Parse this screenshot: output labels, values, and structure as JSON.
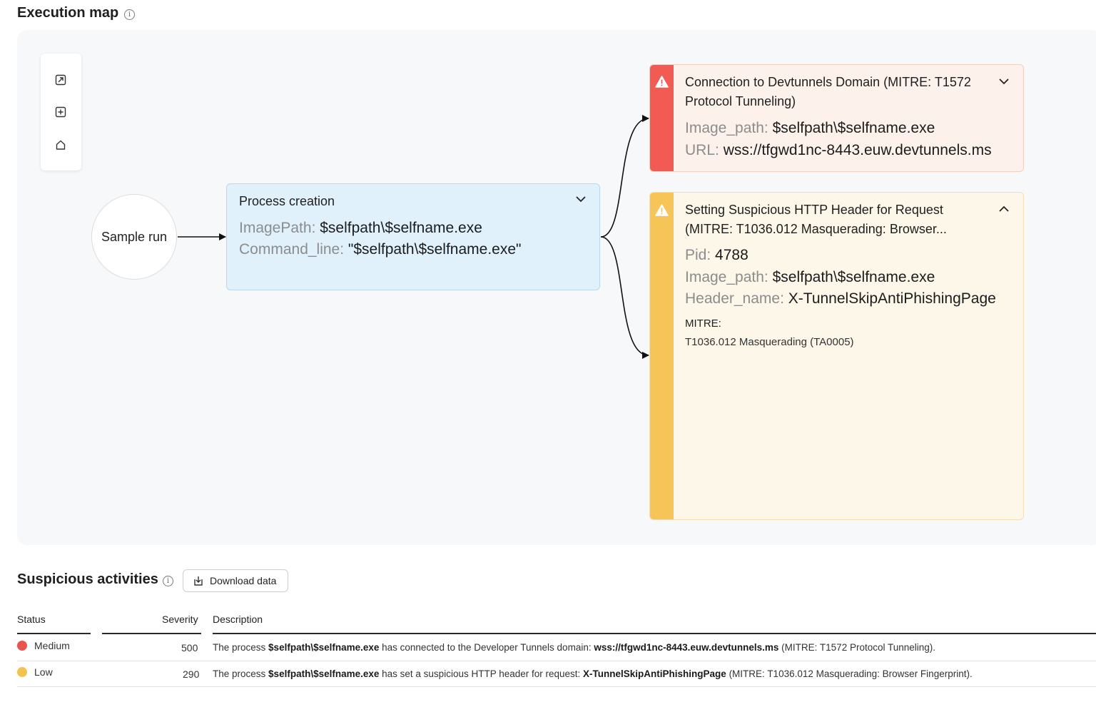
{
  "execution_map": {
    "title": "Execution map",
    "sample_node": "Sample run",
    "process_card": {
      "title": "Process creation",
      "fields": [
        {
          "key": "ImagePath:",
          "value": "$selfpath\\$selfname.exe"
        },
        {
          "key": "Command_line:",
          "value": "\"$selfpath\\$selfname.exe\""
        }
      ]
    },
    "alerts": [
      {
        "severity_color": "#f25b54",
        "title_line1": "Connection to Devtunnels Domain (MITRE: T1572",
        "title_line2": "Protocol Tunneling)",
        "fields": [
          {
            "key": "Image_path:",
            "value": "$selfpath\\$selfname.exe"
          },
          {
            "key": "URL:",
            "value": "wss://tfgwd1nc-8443.euw.devtunnels.ms"
          }
        ]
      },
      {
        "severity_color": "#f6c457",
        "title_line1": "Setting Suspicious HTTP Header for Request",
        "title_line2": "(MITRE: T1036.012 Masquerading: Browser...",
        "fields": [
          {
            "key": "Pid:",
            "value": "4788"
          },
          {
            "key": "Image_path:",
            "value": "$selfpath\\$selfname.exe"
          },
          {
            "key": "Header_name:",
            "value": "X-TunnelSkipAntiPhishingPage"
          }
        ],
        "mitre_label": "MITRE:",
        "mitre_value": "T1036.012 Masquerading (TA0005)"
      }
    ]
  },
  "suspicious": {
    "title": "Suspicious activities",
    "download_label": "Download data",
    "columns": {
      "status": "Status",
      "severity": "Severity",
      "description": "Description"
    },
    "rows": [
      {
        "status": "Medium",
        "status_color": "#e8554e",
        "severity": "500",
        "d1": "The process ",
        "b1": "$selfpath\\$selfname.exe",
        "d2": " has connected to the Developer Tunnels domain: ",
        "b2": "wss://tfgwd1nc-8443.euw.devtunnels.ms",
        "d3": " (MITRE: T1572 Protocol Tunneling)."
      },
      {
        "status": "Low",
        "status_color": "#f3c34f",
        "severity": "290",
        "d1": "The process ",
        "b1": "$selfpath\\$selfname.exe",
        "d2": " has set a suspicious HTTP header for request: ",
        "b2": "X-TunnelSkipAntiPhishingPage",
        "d3": " (MITRE: T1036.012 Masquerading: Browser Fingerprint)."
      }
    ]
  }
}
